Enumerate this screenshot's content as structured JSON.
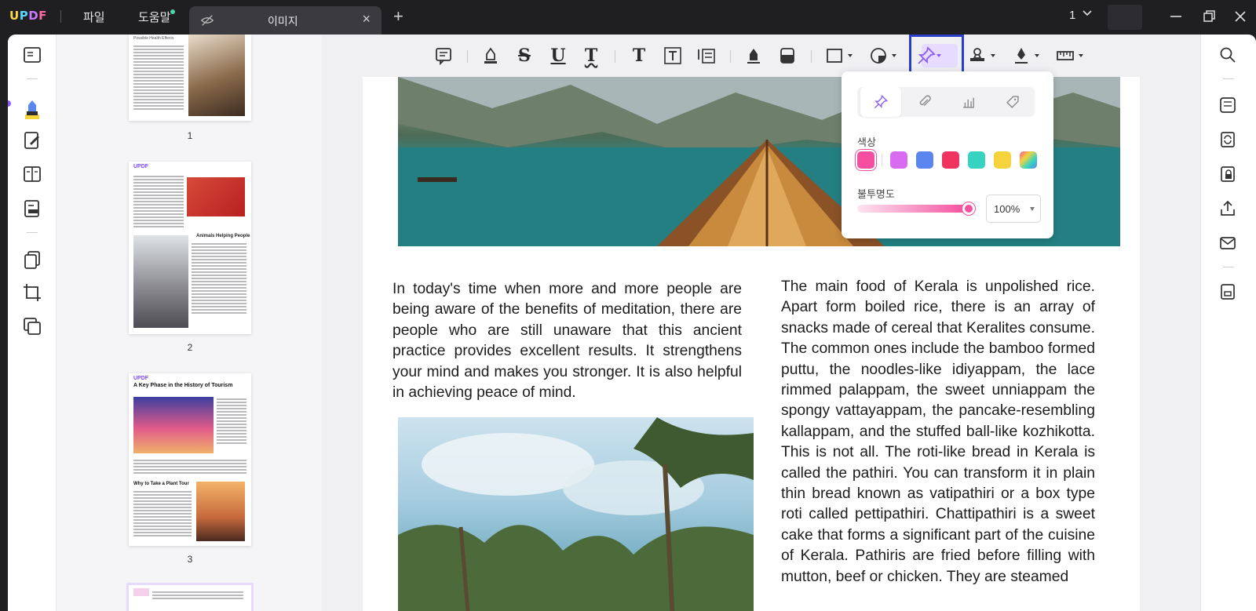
{
  "app": {
    "logo": "UPDF"
  },
  "menu": {
    "file": "파일",
    "help": "도움말"
  },
  "tab": {
    "label": "이미지",
    "close": "×",
    "add": "+"
  },
  "page_indicator": "1",
  "annotation_popover": {
    "color_label": "색상",
    "opacity_label": "불투명도",
    "opacity_value": "100%",
    "swatches": [
      "#f5509f",
      "#d86bf0",
      "#5b86f0",
      "#f0335f",
      "#36d3c0",
      "#f5d33c",
      "rainbow"
    ],
    "selected_swatch": 0,
    "tabs": [
      "pin-icon",
      "paperclip-icon",
      "chart-icon",
      "tag-icon"
    ],
    "active_tab": 0,
    "opacity": 1.0
  },
  "thumbnails": {
    "pages": [
      {
        "number": "1",
        "heading": "Possible Health Effects"
      },
      {
        "number": "2",
        "heading": "Animals Helping People"
      },
      {
        "number": "3",
        "heading": "A Key Phase in the History of Tourism",
        "subheading": "Why to Take a Plant Tour"
      }
    ]
  },
  "document": {
    "left_text": "In today's time when more and more people are being aware of the benefits of meditation, there are people who are still unaware that this ancient practice provides excellent results. It strengthens your mind and makes you stronger. It is also helpful in achieving peace of mind.",
    "right_text": "The main food of Kerala is unpolished rice. Apart form boiled rice, there is an array of snacks made of cereal that Keralites consume. The common ones include the bamboo formed puttu, the noodles-like idiyappam, the lace rimmed palappam, the sweet unniappam the spongy vattayappam, the pancake-resembling kallappam, and the stuffed ball-like kozhikotta. This is not all. The roti-like bread in Kerala is called the pathiri. You can transform it in plain thin bread known as vatipathiri or a box type roti called pettipathiri. Chattipathiri is a sweet cake that forms a significant part of the cuisine of Kerala. Pathiris are fried before filling with mutton, beef or chicken. They are steamed"
  },
  "colors": {
    "accent": "#8b5cf6",
    "highlight_border": "#2b3ec9",
    "pin_bg": "#e7dcff"
  }
}
